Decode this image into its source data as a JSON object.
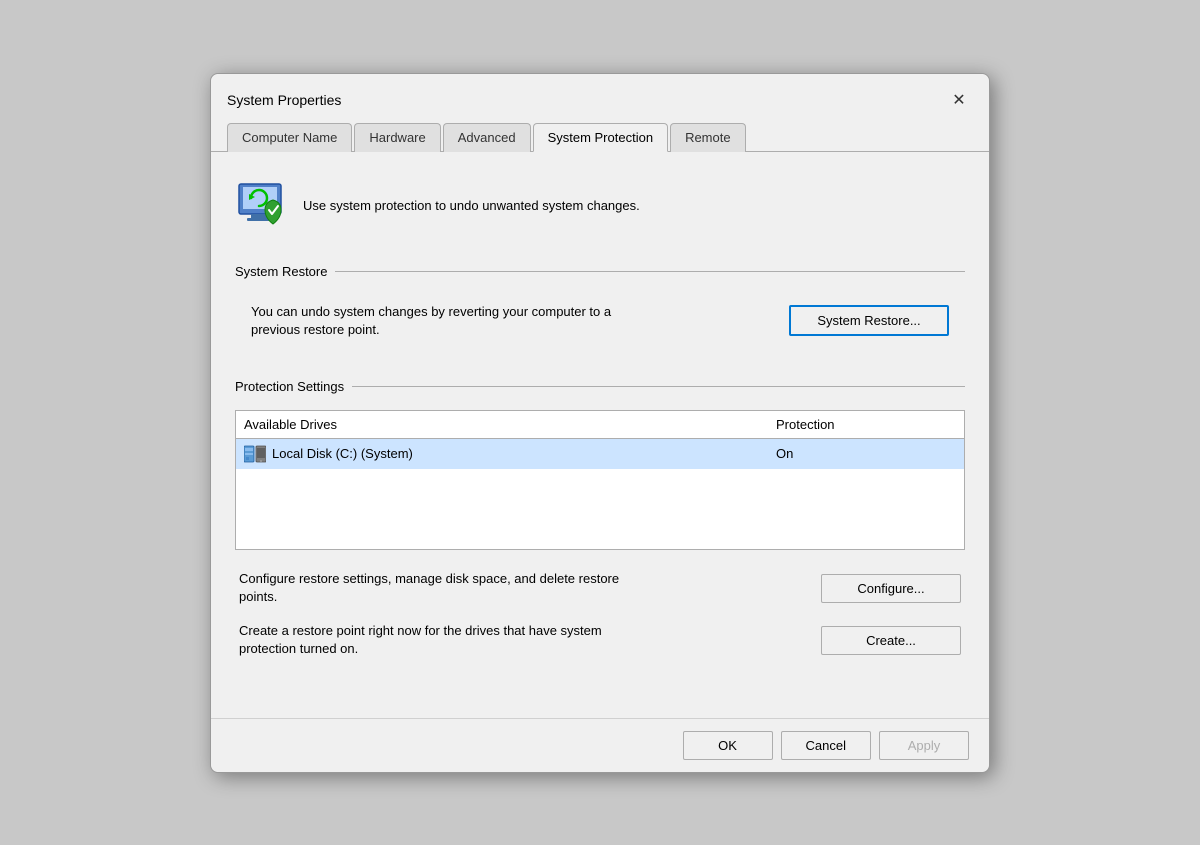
{
  "dialog": {
    "title": "System Properties",
    "close_label": "✕"
  },
  "tabs": [
    {
      "id": "computer-name",
      "label": "Computer Name",
      "active": false
    },
    {
      "id": "hardware",
      "label": "Hardware",
      "active": false
    },
    {
      "id": "advanced",
      "label": "Advanced",
      "active": false
    },
    {
      "id": "system-protection",
      "label": "System Protection",
      "active": true
    },
    {
      "id": "remote",
      "label": "Remote",
      "active": false
    }
  ],
  "info": {
    "text": "Use system protection to undo unwanted system changes."
  },
  "system_restore": {
    "section_label": "System Restore",
    "description": "You can undo system changes by reverting your computer to a previous restore point.",
    "button_label": "System Restore..."
  },
  "protection_settings": {
    "section_label": "Protection Settings",
    "table": {
      "col1": "Available Drives",
      "col2": "Protection",
      "rows": [
        {
          "drive": "Local Disk (C:) (System)",
          "protection": "On"
        }
      ]
    },
    "configure": {
      "text": "Configure restore settings, manage disk space, and delete restore points.",
      "button_label": "Configure..."
    },
    "create": {
      "text": "Create a restore point right now for the drives that have system protection turned on.",
      "button_label": "Create..."
    }
  },
  "footer": {
    "ok_label": "OK",
    "cancel_label": "Cancel",
    "apply_label": "Apply"
  }
}
